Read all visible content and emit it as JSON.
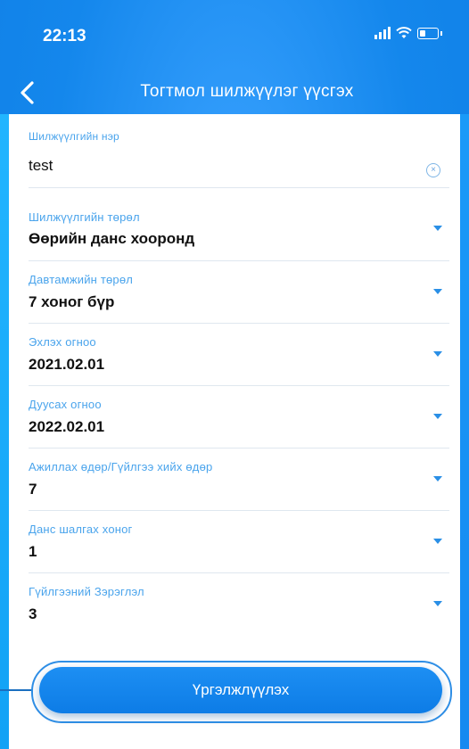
{
  "status_bar": {
    "time": "22:13"
  },
  "header": {
    "title": "Тогтмол шилжүүлэг үүсгэх"
  },
  "form": {
    "fields": [
      {
        "label": "Шилжүүлгийн нэр",
        "value": "test"
      },
      {
        "label": "Шилжүүлгийн төрөл",
        "value": "Өөрийн данс хооронд"
      },
      {
        "label": "Давтамжийн төрөл",
        "value": "7 хоног бүр"
      },
      {
        "label": "Эхлэх огноо",
        "value": "2021.02.01"
      },
      {
        "label": "Дуусах огноо",
        "value": "2022.02.01"
      },
      {
        "label": "Ажиллах өдөр/Гүйлгээ хийх өдөр",
        "value": "7"
      },
      {
        "label": "Данс шалгах хоног",
        "value": "1"
      },
      {
        "label": "Гүйлгээний Зэрэглэл",
        "value": "3"
      }
    ]
  },
  "submit": {
    "label": "Үргэлжлүүлэх"
  },
  "colors": {
    "accent": "#1a8cf0",
    "label": "#4aa4ec"
  }
}
